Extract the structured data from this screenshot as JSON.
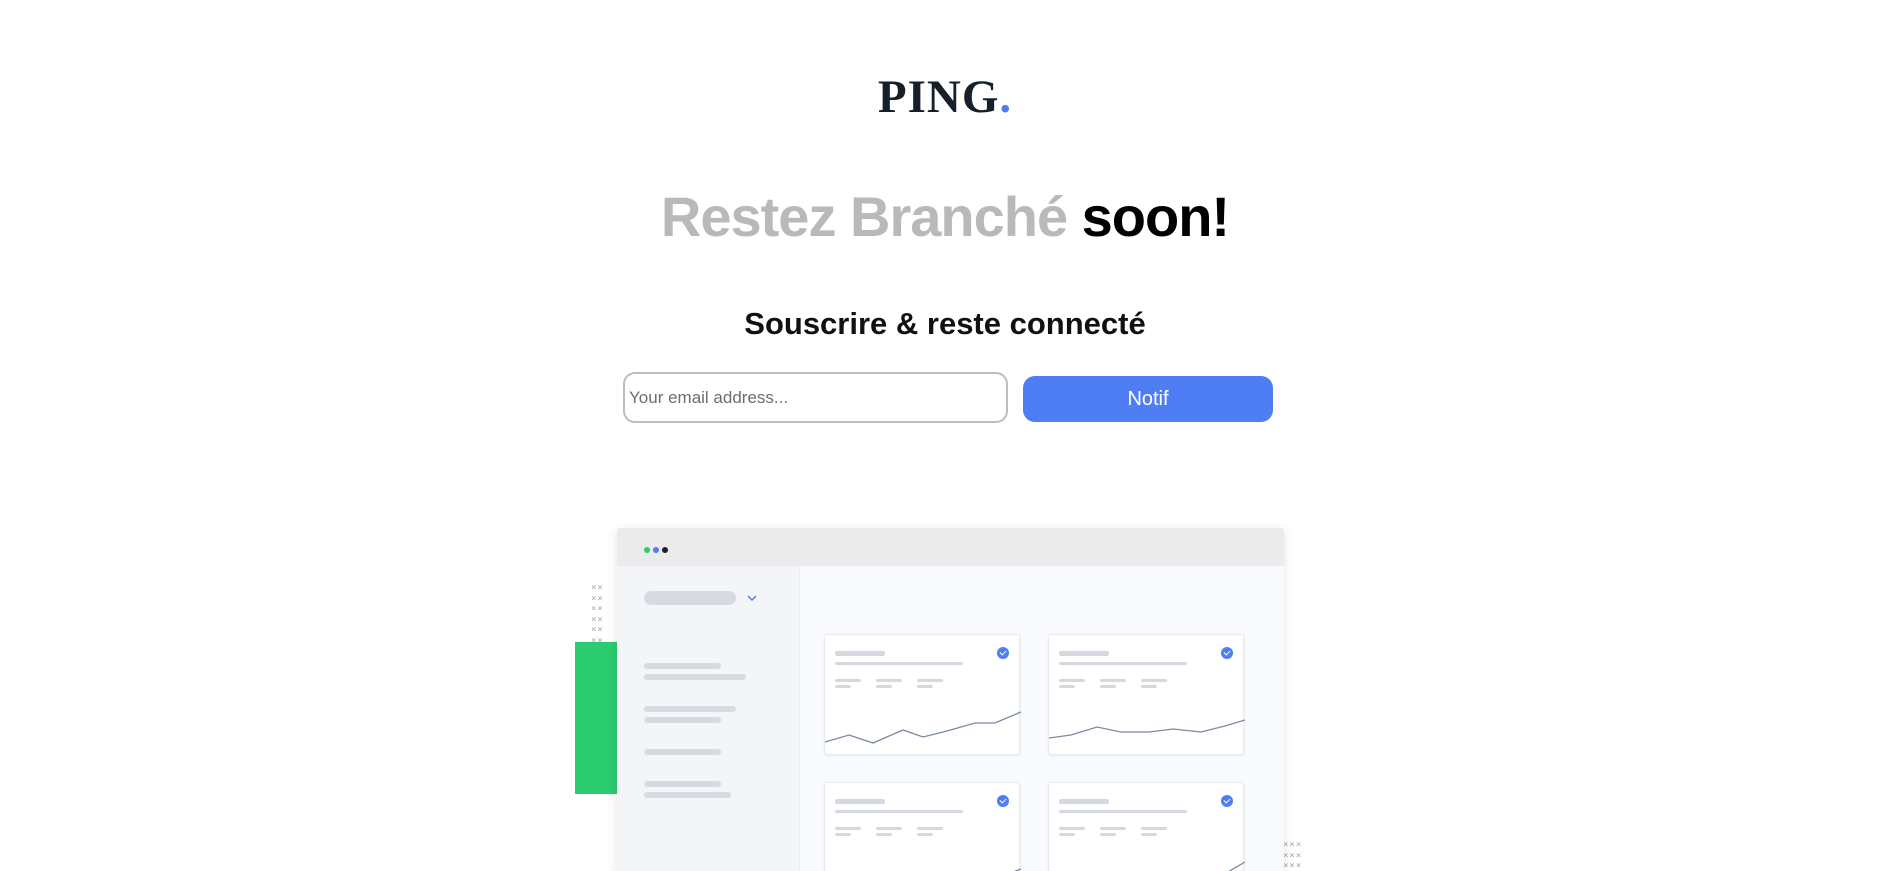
{
  "brand": {
    "name": "PING",
    "dot": "."
  },
  "hero": {
    "title_light": "Restez Branché",
    "title_dark": "soon!",
    "subtitle": "Souscrire & reste connecté"
  },
  "form": {
    "email_placeholder": "Your email address...",
    "email_value": "",
    "submit_label": "Notif"
  },
  "illustration": {
    "name": "dashboard-illustration",
    "window_dots": [
      "#2bcb70",
      "#4f7df3",
      "#15202b"
    ],
    "accent": "#4f7df3",
    "green": "#2bcb70"
  },
  "colors": {
    "primary": "#4f7df3",
    "heading_light": "#b9b9b9",
    "heading_dark": "#000000"
  }
}
